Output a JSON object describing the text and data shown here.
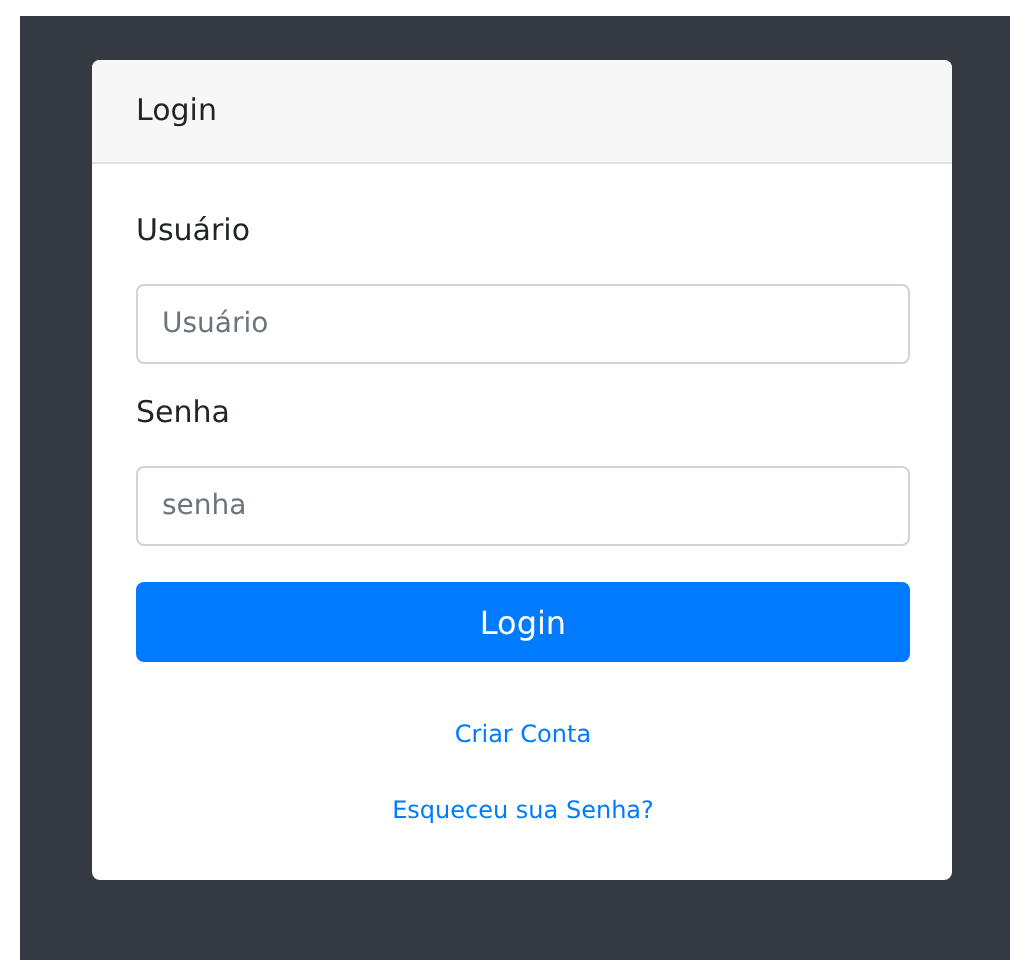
{
  "card": {
    "title": "Login"
  },
  "fields": [
    {
      "label": "Usuário",
      "placeholder": "Usuário"
    },
    {
      "label": "Senha",
      "placeholder": "senha"
    }
  ],
  "button": "Login",
  "links": [
    "Criar Conta",
    "Esqueceu sua Senha?"
  ]
}
